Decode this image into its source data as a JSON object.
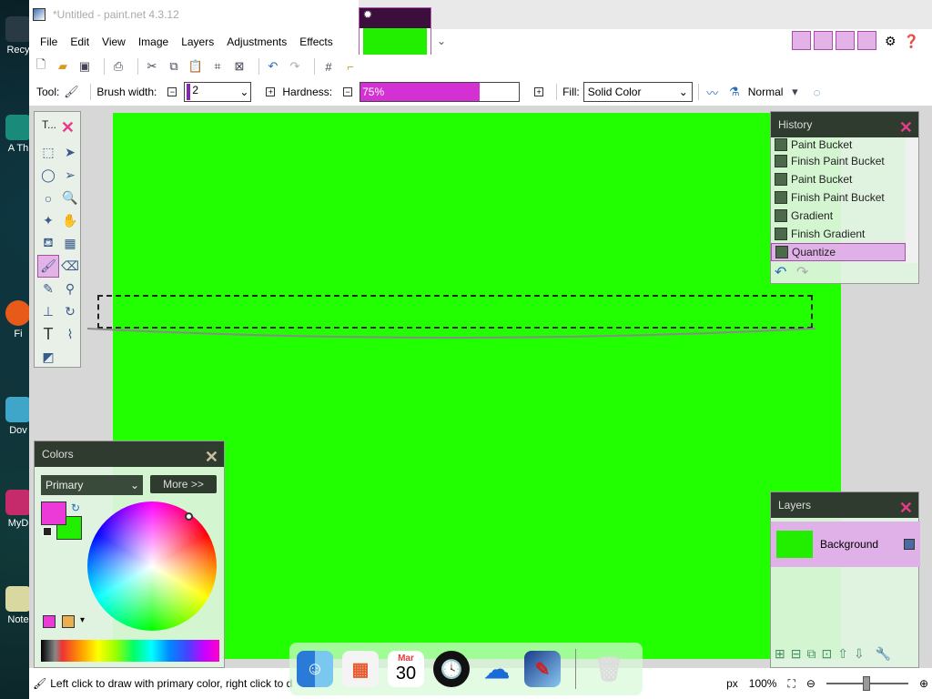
{
  "window": {
    "title": "*Untitled - paint.net 4.3.12"
  },
  "desktop_labels": [
    "Recy",
    "A Th",
    "Fi",
    "Dov",
    "MyD",
    "Note"
  ],
  "menu": [
    "File",
    "Edit",
    "View",
    "Image",
    "Layers",
    "Adjustments",
    "Effects"
  ],
  "toolbar": {
    "tool_label": "Tool:",
    "brush_width_label": "Brush width:",
    "brush_width_value": "2",
    "hardness_label": "Hardness:",
    "hardness_value": "75%",
    "fill_label": "Fill:",
    "fill_value": "Solid Color",
    "blend_mode": "Normal"
  },
  "tools_panel": {
    "title": "T..."
  },
  "history_panel": {
    "title": "History",
    "items": [
      "Paint Bucket",
      "Finish Paint Bucket",
      "Paint Bucket",
      "Finish Paint Bucket",
      "Gradient",
      "Finish Gradient",
      "Quantize"
    ]
  },
  "colors_panel": {
    "title": "Colors",
    "mode": "Primary",
    "more_label": "More >>",
    "primary_color": "#ec3ad9",
    "secondary_color": "#22ee00"
  },
  "layers_panel": {
    "title": "Layers",
    "layer_name": "Background"
  },
  "status": {
    "hint": "Left click to draw with primary color, right click to d",
    "unit": "px",
    "zoom": "100%"
  },
  "dock": {
    "calendar_month": "Mar",
    "calendar_day": "30"
  },
  "canvas_color": "#22ff00"
}
